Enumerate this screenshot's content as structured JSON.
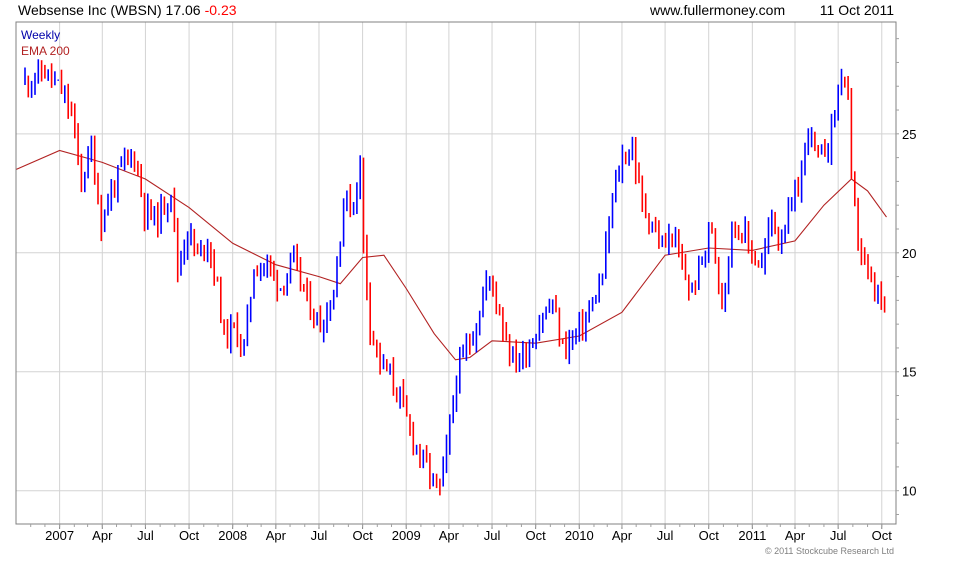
{
  "header": {
    "title_prefix": "Websense Inc (WBSN) 17.06",
    "change": "-0.23",
    "site": "www.fullermoney.com",
    "date": "11 Oct 2011"
  },
  "legend": {
    "weekly": "Weekly",
    "ema": "EMA 200"
  },
  "copyright": "© 2011 Stockcube Research Ltd",
  "colors": {
    "up": "#0000ff",
    "down": "#ff0000",
    "ema": "#b22222",
    "grid": "#d3d3d3",
    "header_text": "#000000",
    "change": "#ff0000"
  },
  "chart_data": {
    "type": "line",
    "title": "Websense Inc (WBSN) 17.06 -0.23",
    "xlabel": "",
    "ylabel": "",
    "y_ticks": [
      10,
      15,
      20,
      25
    ],
    "ylim": [
      8.6,
      29.7
    ],
    "x_ticks": [
      "2007",
      "Apr",
      "Jul",
      "Oct",
      "2008",
      "Apr",
      "Jul",
      "Oct",
      "2009",
      "Apr",
      "Jul",
      "Oct",
      "2010",
      "Apr",
      "Jul",
      "Oct",
      "2011",
      "Apr",
      "Jul",
      "Oct"
    ],
    "x_range": [
      "2006-10-01",
      "2011-10-31"
    ],
    "series": [
      {
        "name": "Weekly",
        "style": "weekly bars",
        "points": [
          [
            "2006-10-20",
            27.2
          ],
          [
            "2006-12-01",
            27.6
          ],
          [
            "2007-01-05",
            26.8
          ],
          [
            "2007-01-26",
            25.8
          ],
          [
            "2007-02-16",
            23.0
          ],
          [
            "2007-03-09",
            24.4
          ],
          [
            "2007-03-30",
            21.3
          ],
          [
            "2007-04-20",
            22.6
          ],
          [
            "2007-05-18",
            23.8
          ],
          [
            "2007-06-08",
            24.1
          ],
          [
            "2007-06-29",
            21.8
          ],
          [
            "2007-07-27",
            21.4
          ],
          [
            "2007-08-24",
            22.7
          ],
          [
            "2007-09-07",
            19.3
          ],
          [
            "2007-09-28",
            21.0
          ],
          [
            "2007-10-19",
            19.8
          ],
          [
            "2007-11-09",
            20.6
          ],
          [
            "2007-11-30",
            18.5
          ],
          [
            "2007-12-14",
            16.5
          ],
          [
            "2008-01-04",
            16.8
          ],
          [
            "2008-01-25",
            16.0
          ],
          [
            "2008-02-15",
            19.4
          ],
          [
            "2008-03-14",
            19.5
          ],
          [
            "2008-04-11",
            18.6
          ],
          [
            "2008-05-09",
            19.6
          ],
          [
            "2008-06-06",
            18.0
          ],
          [
            "2008-07-04",
            16.9
          ],
          [
            "2008-08-01",
            18.3
          ],
          [
            "2008-08-22",
            22.2
          ],
          [
            "2008-09-12",
            22.0
          ],
          [
            "2008-09-26",
            23.8
          ],
          [
            "2008-10-03",
            20.3
          ],
          [
            "2008-10-17",
            17.0
          ],
          [
            "2008-11-07",
            15.4
          ],
          [
            "2008-11-28",
            14.8
          ],
          [
            "2008-12-19",
            13.9
          ],
          [
            "2009-01-09",
            12.5
          ],
          [
            "2009-02-06",
            11.2
          ],
          [
            "2009-02-27",
            10.4
          ],
          [
            "2009-03-13",
            10.0
          ],
          [
            "2009-03-27",
            11.7
          ],
          [
            "2009-04-17",
            14.8
          ],
          [
            "2009-05-08",
            16.0
          ],
          [
            "2009-05-29",
            17.0
          ],
          [
            "2009-06-19",
            18.8
          ],
          [
            "2009-07-03",
            18.6
          ],
          [
            "2009-07-24",
            17.0
          ],
          [
            "2009-08-14",
            15.5
          ],
          [
            "2009-09-04",
            15.7
          ],
          [
            "2009-09-25",
            16.4
          ],
          [
            "2009-10-16",
            17.4
          ],
          [
            "2009-11-06",
            17.8
          ],
          [
            "2009-11-27",
            16.0
          ],
          [
            "2009-12-18",
            16.4
          ],
          [
            "2010-01-08",
            17.0
          ],
          [
            "2010-01-29",
            17.8
          ],
          [
            "2010-02-19",
            19.0
          ],
          [
            "2010-03-12",
            22.3
          ],
          [
            "2010-04-02",
            24.0
          ],
          [
            "2010-04-23",
            24.4
          ],
          [
            "2010-05-14",
            22.0
          ],
          [
            "2010-06-04",
            21.2
          ],
          [
            "2010-06-25",
            20.2
          ],
          [
            "2010-07-16",
            20.8
          ],
          [
            "2010-08-06",
            19.3
          ],
          [
            "2010-08-27",
            18.3
          ],
          [
            "2010-09-17",
            19.8
          ],
          [
            "2010-10-08",
            21.0
          ],
          [
            "2010-10-29",
            18.0
          ],
          [
            "2010-11-19",
            21.0
          ],
          [
            "2010-12-10",
            21.0
          ],
          [
            "2010-12-31",
            20.0
          ],
          [
            "2011-01-21",
            19.4
          ],
          [
            "2011-02-11",
            21.6
          ],
          [
            "2011-02-25",
            20.6
          ],
          [
            "2011-03-18",
            21.5
          ],
          [
            "2011-04-08",
            22.7
          ],
          [
            "2011-04-29",
            25.2
          ],
          [
            "2011-05-20",
            23.8
          ],
          [
            "2011-06-10",
            24.6
          ],
          [
            "2011-06-24",
            26.0
          ],
          [
            "2011-07-08",
            27.6
          ],
          [
            "2011-07-22",
            26.5
          ],
          [
            "2011-07-29",
            22.8
          ],
          [
            "2011-08-12",
            20.7
          ],
          [
            "2011-09-02",
            18.8
          ],
          [
            "2011-09-23",
            18.2
          ],
          [
            "2011-10-07",
            17.3
          ],
          [
            "2011-10-11",
            17.06
          ]
        ]
      },
      {
        "name": "EMA 200",
        "style": "line",
        "points": [
          [
            "2006-10-01",
            23.5
          ],
          [
            "2007-01-01",
            24.3
          ],
          [
            "2007-04-01",
            23.8
          ],
          [
            "2007-07-01",
            23.1
          ],
          [
            "2007-10-01",
            21.9
          ],
          [
            "2008-01-01",
            20.4
          ],
          [
            "2008-04-01",
            19.5
          ],
          [
            "2008-07-01",
            19.0
          ],
          [
            "2008-08-15",
            18.7
          ],
          [
            "2008-10-01",
            19.8
          ],
          [
            "2008-11-15",
            19.9
          ],
          [
            "2009-01-01",
            18.5
          ],
          [
            "2009-03-01",
            16.6
          ],
          [
            "2009-04-15",
            15.5
          ],
          [
            "2009-05-15",
            15.6
          ],
          [
            "2009-07-01",
            16.3
          ],
          [
            "2009-10-01",
            16.2
          ],
          [
            "2010-01-01",
            16.5
          ],
          [
            "2010-04-01",
            17.5
          ],
          [
            "2010-07-01",
            19.9
          ],
          [
            "2010-10-01",
            20.2
          ],
          [
            "2011-01-01",
            20.1
          ],
          [
            "2011-04-01",
            20.5
          ],
          [
            "2011-06-01",
            22.0
          ],
          [
            "2011-07-29",
            23.1
          ],
          [
            "2011-09-01",
            22.6
          ],
          [
            "2011-10-11",
            21.5
          ]
        ]
      }
    ]
  }
}
